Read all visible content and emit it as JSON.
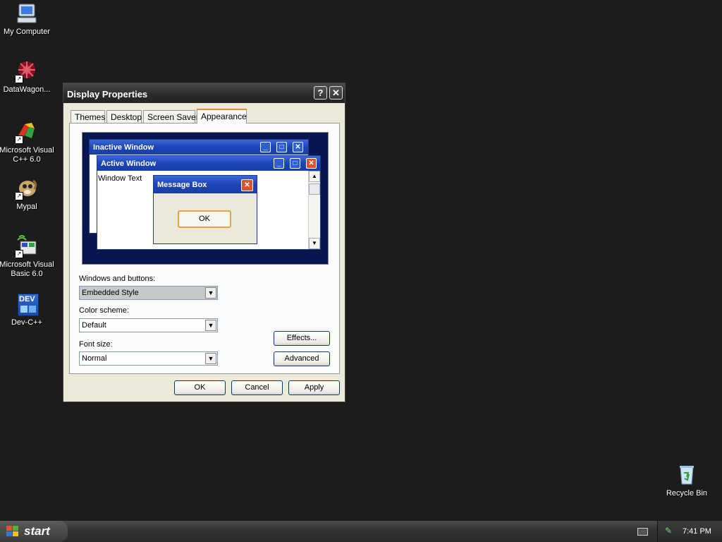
{
  "desktop": {
    "icons": [
      {
        "label": "My Computer",
        "icon": "my-computer-icon"
      },
      {
        "label": "DataWagon...",
        "icon": "datawagon-icon"
      },
      {
        "label": "Microsoft Visual C++ 6.0",
        "icon": "visual-cpp-icon"
      },
      {
        "label": "Mypal",
        "icon": "mypal-icon"
      },
      {
        "label": "Microsoft Visual Basic 6.0",
        "icon": "visual-basic-icon"
      },
      {
        "label": "Dev-C++",
        "icon": "dev-cpp-icon"
      },
      {
        "label": "Recycle Bin",
        "icon": "recycle-bin-icon"
      }
    ],
    "dev_badge": "DEV"
  },
  "dialog": {
    "title": "Display Properties",
    "help_glyph": "?",
    "close_glyph": "✕",
    "tabs": [
      {
        "label": "Themes"
      },
      {
        "label": "Desktop"
      },
      {
        "label": "Screen Saver"
      },
      {
        "label": "Appearance",
        "active": true
      }
    ],
    "preview": {
      "inactive_title": "Inactive Window",
      "active_title": "Active Window",
      "window_text": "Window Text",
      "message_title": "Message Box",
      "ok_label": "OK"
    },
    "windows_buttons_label": "Windows and buttons:",
    "windows_buttons_value": "Embedded Style",
    "color_scheme_label": "Color scheme:",
    "color_scheme_value": "Default",
    "font_size_label": "Font size:",
    "font_size_value": "Normal",
    "effects_label": "Effects...",
    "advanced_label": "Advanced",
    "ok_label": "OK",
    "cancel_label": "Cancel",
    "apply_label": "Apply"
  },
  "taskbar": {
    "start_label": "start",
    "clock": "7:41 PM"
  },
  "colors": {
    "desktop": "#1c1c1c",
    "dialog_face": "#ece9d8",
    "preview_bg": "#0a1650",
    "title_blue": "#1d44b8",
    "close_red": "#d9532c"
  }
}
